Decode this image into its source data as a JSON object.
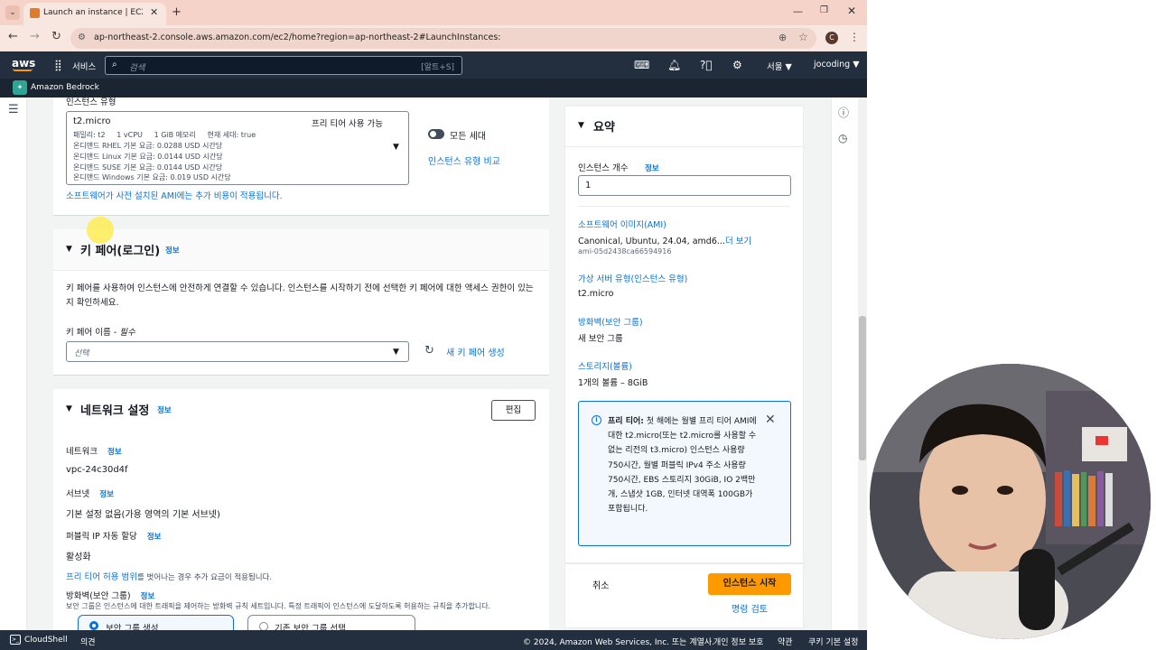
{
  "browser": {
    "tab_title": "Launch an instance | EC2 | ap-",
    "tab_close": "✕",
    "new_tab": "+",
    "url": "ap-northeast-2.console.aws.amazon.com/ec2/home?region=ap-northeast-2#LaunchInstances:",
    "profile_initial": "C"
  },
  "aws_header": {
    "logo": "aws",
    "services": "서비스",
    "search_placeholder": "검색",
    "search_shortcut": "[알트+S]",
    "region": "서울 ▼",
    "user": "jocoding ▼",
    "favorite": "Amazon Bedrock"
  },
  "instance_type": {
    "label": "인스턴스 유형",
    "name": "t2.micro",
    "free_tier": "프리 티어 사용 가능",
    "details": [
      "패밀리: t2     1 vCPU     1 GiB 메모리     현재 세대: true",
      "온디맨드 RHEL 기본 요금: 0.0288 USD 시간당",
      "온디맨드 Linux 기본 요금: 0.0144 USD 시간당",
      "온디맨드 SUSE 기본 요금: 0.0144 USD 시간당",
      "온디맨드 Windows 기본 요금: 0.019 USD 시간당"
    ],
    "all_generations": "모든 세대",
    "compare": "인스턴스 유형 비교",
    "ami_cost_link": "소프트웨어가 사전 설치된 AMI에는 추가 비용이 적용됩니다."
  },
  "key_pair": {
    "title": "키 페어(로그인)",
    "info": "정보",
    "description": "키 페어를 사용하여 인스턴스에 안전하게 연결할 수 있습니다. 인스턴스를 시작하기 전에 선택한 키 페어에 대한 액세스 권한이 있는지 확인하세요.",
    "name_label": "키 페어 이름 - ",
    "required": "필수",
    "select_placeholder": "선택",
    "create_new": "새 키 페어 생성"
  },
  "network": {
    "title": "네트워크 설정",
    "info": "정보",
    "edit": "편집",
    "network_label": "네트워크",
    "network_value": "vpc-24c30d4f",
    "subnet_label": "서브넷",
    "subnet_value": "기본 설정 없음(가용 영역의 기본 서브넷)",
    "public_ip_label": "퍼블릭 IP 자동 할당",
    "public_ip_value": "활성화",
    "free_tier_range_link": "프리 티어 허용 범위",
    "free_tier_range_rest": "를 벗어나는 경우 추가 요금이 적용됩니다.",
    "firewall_label": "방화벽(보안 그룹)",
    "firewall_note": "보안 그룹은 인스턴스에 대한 트래픽을 제어하는 방화벽 규칙 세트입니다. 특정 트래픽이 인스턴스에 도달하도록 허용하는 규칙을 추가합니다.",
    "option_create": "보안 그룹 생성",
    "option_existing": "기존 보안 그룹 선택"
  },
  "summary": {
    "title": "요약",
    "count_label": "인스턴스 개수",
    "info": "정보",
    "count_value": "1",
    "ami_label": "소프트웨어 이미지(AMI)",
    "ami_value": "Canonical, Ubuntu, 24.04, amd6...",
    "ami_more": "더 보기",
    "ami_id": "ami-05d2438ca66594916",
    "type_label": "가상 서버 유형(인스턴스 유형)",
    "type_value": "t2.micro",
    "firewall_label": "방화벽(보안 그룹)",
    "firewall_value": "새 보안 그룹",
    "storage_label": "스토리지(볼륨)",
    "storage_value": "1개의 볼륨 – 8GiB",
    "free_tier_bold": "프리 티어:",
    "free_tier_text": " 첫 해에는 월별 프리 티어 AMI에 대한 t2.micro(또는 t2.micro를 사용할 수 없는 리전의 t3.micro) 인스턴스 사용량 750시간, 월별 퍼블릭 IPv4 주소 사용량 750시간, EBS 스토리지 30GiB, IO 2백만 개, 스냅샷 1GB, 인터넷 대역폭 100GB가 포함됩니다.",
    "cancel": "취소",
    "launch": "인스턴스 시작",
    "review": "명령 검토"
  },
  "footer": {
    "cloudshell": "CloudShell",
    "feedback": "의견",
    "copyright": "© 2024, Amazon Web Services, Inc. 또는 계열사.",
    "privacy": "개인 정보 보호",
    "terms": "약관",
    "cookies": "쿠키 기본 설정"
  },
  "icons": {
    "tab_menu": "chevron-down-icon",
    "back": "arrow-left-icon",
    "forward": "arrow-right-icon",
    "reload": "reload-icon",
    "site_info": "tune-icon",
    "zoom": "zoom-icon",
    "star": "star-icon",
    "services_grid": "grid-icon",
    "search": "search-icon",
    "cloudshell_header": "terminal-icon",
    "notifications": "bell-icon",
    "help": "question-icon",
    "settings": "gear-icon",
    "hamburger": "menu-icon",
    "info_panel": "info-icon",
    "history": "clock-icon",
    "refresh": "refresh-icon"
  },
  "colors": {
    "aws_header": "#232f3e",
    "link": "#0972d3",
    "launch_button": "#ff9900"
  }
}
